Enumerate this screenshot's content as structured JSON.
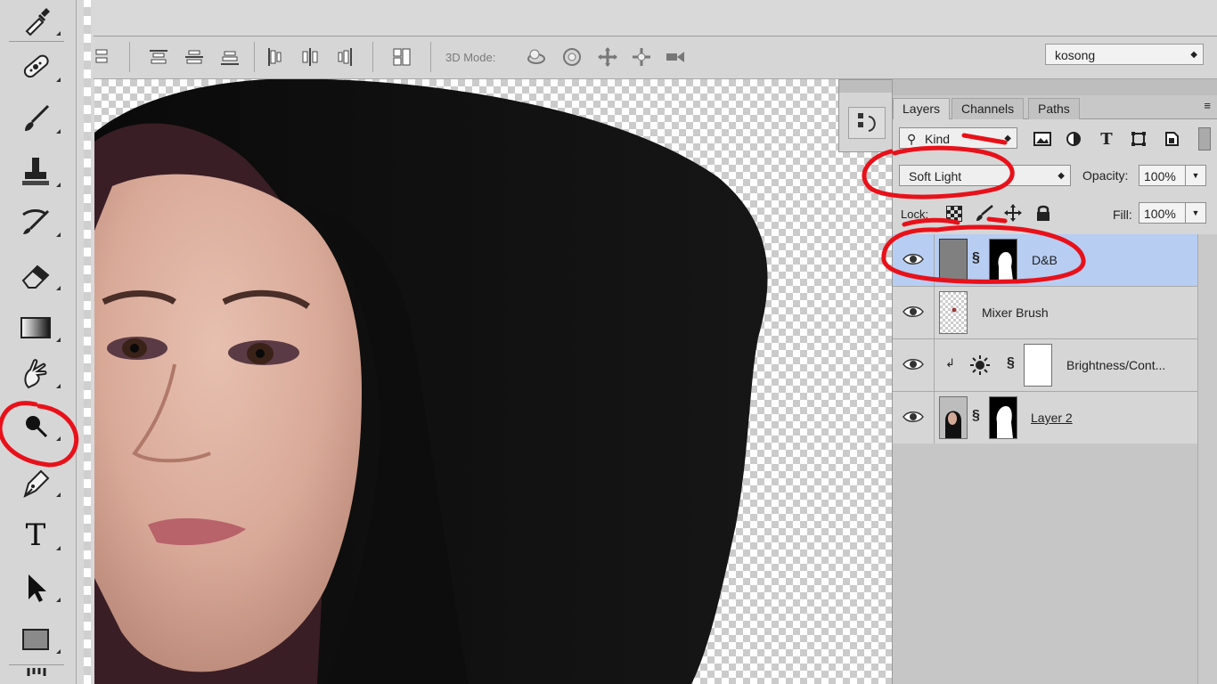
{
  "toolbar": {
    "tools": [
      {
        "name": "eyedropper-icon",
        "active": false
      },
      {
        "name": "healing-brush-icon",
        "active": false
      },
      {
        "name": "brush-icon",
        "active": false
      },
      {
        "name": "clone-stamp-icon",
        "active": false
      },
      {
        "name": "history-brush-icon",
        "active": false
      },
      {
        "name": "eraser-icon",
        "active": false
      },
      {
        "name": "gradient-icon",
        "active": false
      },
      {
        "name": "smudge-icon",
        "active": false
      },
      {
        "name": "burn-icon",
        "active": true
      },
      {
        "name": "pen-icon",
        "active": false
      },
      {
        "name": "type-icon",
        "label": "T",
        "active": false
      },
      {
        "name": "path-selection-icon",
        "active": false
      },
      {
        "name": "rectangle-icon",
        "active": false
      }
    ]
  },
  "options_bar": {
    "mode_label": "3D Mode:",
    "workspace": "kosong",
    "align_icons": [
      "align-left-edges-icon",
      "align-top-edges-icon",
      "align-vertical-centers-icon",
      "align-bottom-edges-icon",
      "distribute-left-icon",
      "distribute-horizontal-icon",
      "distribute-right-icon",
      "auto-align-icon"
    ],
    "mode_icons": [
      "rotate-3d-icon",
      "roll-3d-icon",
      "drag-3d-icon",
      "slide-3d-icon",
      "scale-3d-icon"
    ]
  },
  "layers_panel": {
    "tabs": [
      {
        "label": "Layers",
        "active": true
      },
      {
        "label": "Channels",
        "active": false
      },
      {
        "label": "Paths",
        "active": false
      }
    ],
    "filter": "Kind",
    "blend_mode": "Soft Light",
    "opacity_label": "Opacity:",
    "opacity": "100%",
    "lock_label": "Lock:",
    "fill_label": "Fill:",
    "fill": "100%",
    "layers": [
      {
        "name": "D&B",
        "selected": true,
        "visible": true,
        "has_mask": true
      },
      {
        "name": "Mixer Brush",
        "selected": false,
        "visible": true,
        "has_mask": false
      },
      {
        "name": "Brightness/Cont...",
        "selected": false,
        "visible": true,
        "has_mask": true,
        "adjustment": true
      },
      {
        "name": "Layer 2",
        "selected": false,
        "visible": true,
        "has_mask": true,
        "underlined": true
      }
    ]
  },
  "colors": {
    "annotation": "#e8111a",
    "selection": "#b7cdf2",
    "panel": "#d6d6d6"
  }
}
